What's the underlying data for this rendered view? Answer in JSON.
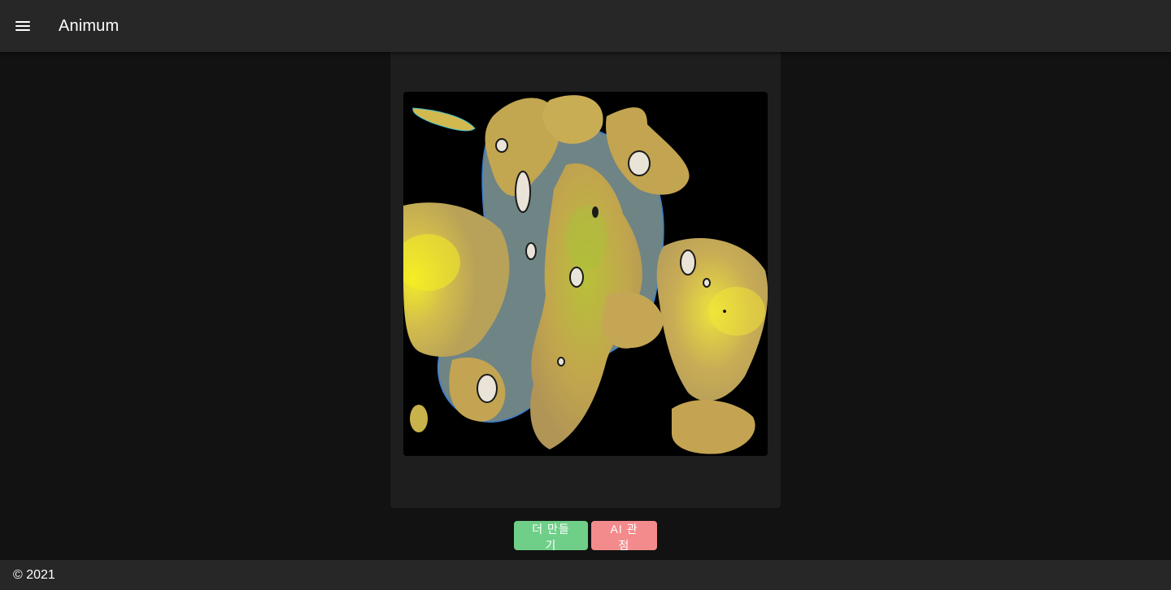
{
  "header": {
    "menu_icon": "menu-icon",
    "title": "Animum"
  },
  "artwork": {
    "description_icon": "generated-artwork",
    "colors": {
      "background": "#000000",
      "body": "#c5a84f",
      "highlight": "#e8e23a",
      "water": "#6f8485"
    }
  },
  "actions": {
    "more_label": "더 만들기",
    "ai_label": "AI 관점",
    "more_color": "#6fcf89",
    "ai_color": "#f38b8c"
  },
  "footer": {
    "copyright": "© 2021"
  }
}
